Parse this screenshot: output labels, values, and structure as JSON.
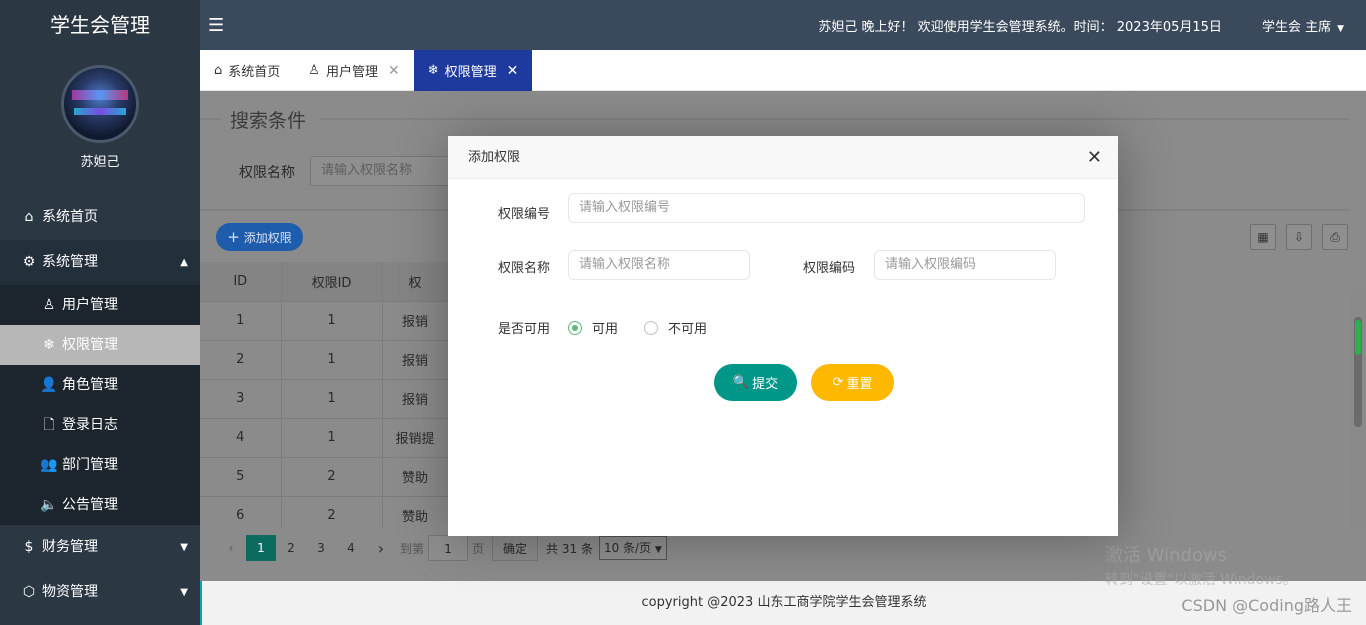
{
  "sidebar": {
    "brand": "学生会管理",
    "username": "苏妲己",
    "items": [
      {
        "label": "系统首页",
        "icon": "home-icon"
      },
      {
        "label": "系统管理",
        "icon": "gear-icon"
      },
      {
        "label": "用户管理",
        "icon": "user-icon"
      },
      {
        "label": "权限管理",
        "icon": "snowflake-icon"
      },
      {
        "label": "角色管理",
        "icon": "person-icon"
      },
      {
        "label": "登录日志",
        "icon": "file-icon"
      },
      {
        "label": "部门管理",
        "icon": "group-icon"
      },
      {
        "label": "公告管理",
        "icon": "speaker-icon"
      },
      {
        "label": "财务管理",
        "icon": "dollar-icon"
      },
      {
        "label": "物资管理",
        "icon": "box-icon"
      }
    ]
  },
  "header": {
    "greeting": "苏妲己 晚上好！ 欢迎使用学生会管理系统。时间： 2023年05月15日",
    "role": "学生会 主席"
  },
  "tabs": [
    {
      "label": "系统首页"
    },
    {
      "label": "用户管理"
    },
    {
      "label": "权限管理"
    }
  ],
  "search": {
    "legend": "搜索条件",
    "label": "权限名称",
    "placeholder": "请输入权限名称"
  },
  "toolbar": {
    "add_label": "添加权限"
  },
  "table": {
    "headers": [
      "ID",
      "权限ID",
      "权"
    ],
    "rows": [
      [
        "1",
        "1",
        "报销"
      ],
      [
        "2",
        "1",
        "报销"
      ],
      [
        "3",
        "1",
        "报销"
      ],
      [
        "4",
        "1",
        "报销提"
      ],
      [
        "5",
        "2",
        "赞助"
      ],
      [
        "6",
        "2",
        "赞助"
      ]
    ]
  },
  "pager": {
    "pages": [
      "1",
      "2",
      "3",
      "4"
    ],
    "goto_label": "到第",
    "goto_value": "1",
    "page_unit": "页",
    "confirm": "确定",
    "total": "共 31 条",
    "page_size": "10 条/页"
  },
  "footer": {
    "copyright": "copyright @2023 山东工商学院学生会管理系统"
  },
  "watermark": {
    "csdn": "CSDN @Coding路人王",
    "win_line1": "激活 Windows",
    "win_line2": "转到\"设置\"以激活 Windows。"
  },
  "modal": {
    "title": "添加权限",
    "fields": {
      "code_label": "权限编号",
      "code_placeholder": "请输入权限编号",
      "name_label": "权限名称",
      "name_placeholder": "请输入权限名称",
      "key_label": "权限编码",
      "key_placeholder": "请输入权限编码",
      "enabled_label": "是否可用",
      "enabled_yes": "可用",
      "enabled_no": "不可用"
    },
    "submit": "提交",
    "reset": "重置"
  },
  "colors": {
    "active_tab": "#1e3a9e",
    "submit": "#009688",
    "reset": "#ffb800",
    "header": "#3a4a5c"
  }
}
